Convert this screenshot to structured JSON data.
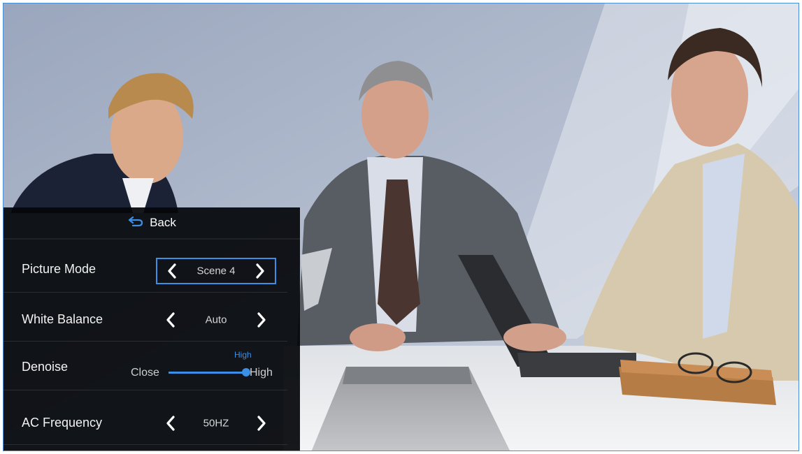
{
  "osd": {
    "back_label": "Back",
    "rows": [
      {
        "label": "Picture Mode",
        "value": "Scene 4"
      },
      {
        "label": "White Balance",
        "value": "Auto"
      },
      {
        "label": "Denoise",
        "slider_min_label": "Close",
        "slider_max_label": "High",
        "slider_value_label": "High",
        "slider_level": 1.0
      },
      {
        "label": "AC Frequency",
        "value": "50HZ"
      }
    ]
  },
  "colors": {
    "accent": "#3c8fe6",
    "panel_bg": "#05070b"
  }
}
